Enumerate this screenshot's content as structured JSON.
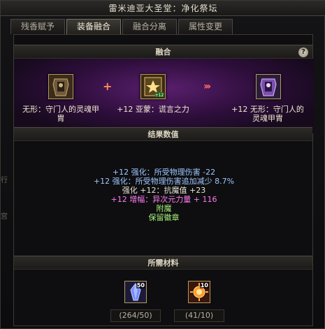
{
  "window": {
    "title": "雷米迪亚大圣堂：净化祭坛"
  },
  "tabs": [
    {
      "label": "残香赋予"
    },
    {
      "label": "装备融合"
    },
    {
      "label": "融合分离"
    },
    {
      "label": "属性变更"
    }
  ],
  "fusion": {
    "header": "融合",
    "help_icon": "?",
    "item_left": {
      "name": "无形：守门人的灵魂甲胄",
      "icon": "armor-icon"
    },
    "plus_symbol": "+",
    "item_middle": {
      "name": "+12 亚蒙：谎言之力",
      "icon": "card-icon",
      "badge": "+12"
    },
    "arrows_symbol": "›››",
    "item_result": {
      "name": "+12 无形：守门人的灵魂甲胄",
      "icon": "armor-result-icon"
    }
  },
  "results": {
    "header": "结果数值",
    "lines": [
      {
        "text": "+12 强化：所受物理伤害 -22",
        "color": "#9ec7ff"
      },
      {
        "text": "+12 强化：所受物理伤害追加减少 8.7%",
        "color": "#9ec7ff"
      },
      {
        "text": "强化 +12：抗魔值 +23",
        "color": "#e8e3d6"
      },
      {
        "text": "+12 增幅：异次元力量 + 116",
        "color": "#ff7cf2"
      },
      {
        "text": "附魔",
        "color": "#a8f07a"
      },
      {
        "text": "保留徽章",
        "color": "#a8f07a"
      }
    ]
  },
  "materials": {
    "header": "所需材料",
    "items": [
      {
        "icon": "crystal-icon",
        "count": "50",
        "need": "(264/50)"
      },
      {
        "icon": "sun-orb-icon",
        "count": "10",
        "need": "(41/10)"
      }
    ]
  },
  "side": {
    "left_glyph_1": "行",
    "left_glyph_2": "宫"
  }
}
